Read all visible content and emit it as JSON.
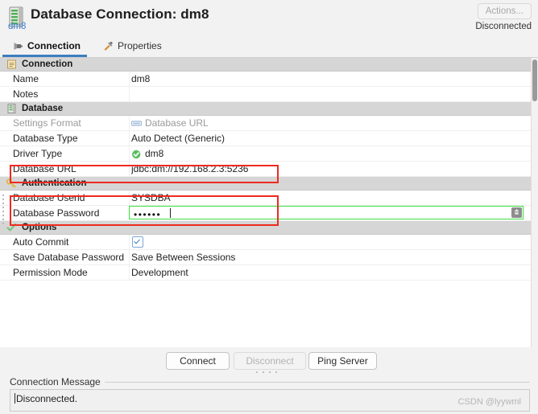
{
  "header": {
    "icon": "database-server-icon",
    "title": "Database Connection: dm8",
    "actions_label": "Actions...",
    "subtitle": "dm8",
    "status": "Disconnected"
  },
  "tabs": [
    {
      "label": "Connection",
      "icon": "plug-icon",
      "active": true
    },
    {
      "label": "Properties",
      "icon": "tools-icon",
      "active": false
    }
  ],
  "sections": {
    "connection": {
      "label": "Connection",
      "icon": "note-icon"
    },
    "database": {
      "label": "Database",
      "icon": "database-icon"
    },
    "authentication": {
      "label": "Authentication",
      "icon": "key-icon"
    },
    "options": {
      "label": "Options",
      "icon": "checkmark-icon"
    }
  },
  "fields": {
    "name": {
      "label": "Name",
      "value": "dm8"
    },
    "notes": {
      "label": "Notes",
      "value": ""
    },
    "settings_format": {
      "label": "Settings Format",
      "value": "Database URL",
      "icon": "url-chip-icon"
    },
    "database_type": {
      "label": "Database Type",
      "value": "Auto Detect (Generic)"
    },
    "driver_type": {
      "label": "Driver Type",
      "value": "dm8",
      "icon": "green-check-icon"
    },
    "database_url": {
      "label": "Database URL",
      "value": "jdbc:dm://192.168.2.3:5236"
    },
    "database_userid": {
      "label": "Database Userid",
      "value": "SYSDBA"
    },
    "database_password": {
      "label": "Database Password",
      "value": "••••••",
      "char_count": 6
    },
    "auto_commit": {
      "label": "Auto Commit",
      "checked": true
    },
    "save_database_password": {
      "label": "Save Database Password",
      "value": "Save Between Sessions"
    },
    "permission_mode": {
      "label": "Permission Mode",
      "value": "Development"
    }
  },
  "buttons": {
    "connect": "Connect",
    "disconnect": "Disconnect",
    "ping_server": "Ping Server"
  },
  "connection_message": {
    "label": "Connection Message",
    "text": "Disconnected."
  },
  "watermark": "CSDN @lyywml",
  "colors": {
    "accent": "#3d7ec0",
    "annotation": "#ee2a1f",
    "focus": "#3ee13e",
    "link": "#3c7fd0",
    "section_bg": "#d6d6d6"
  }
}
